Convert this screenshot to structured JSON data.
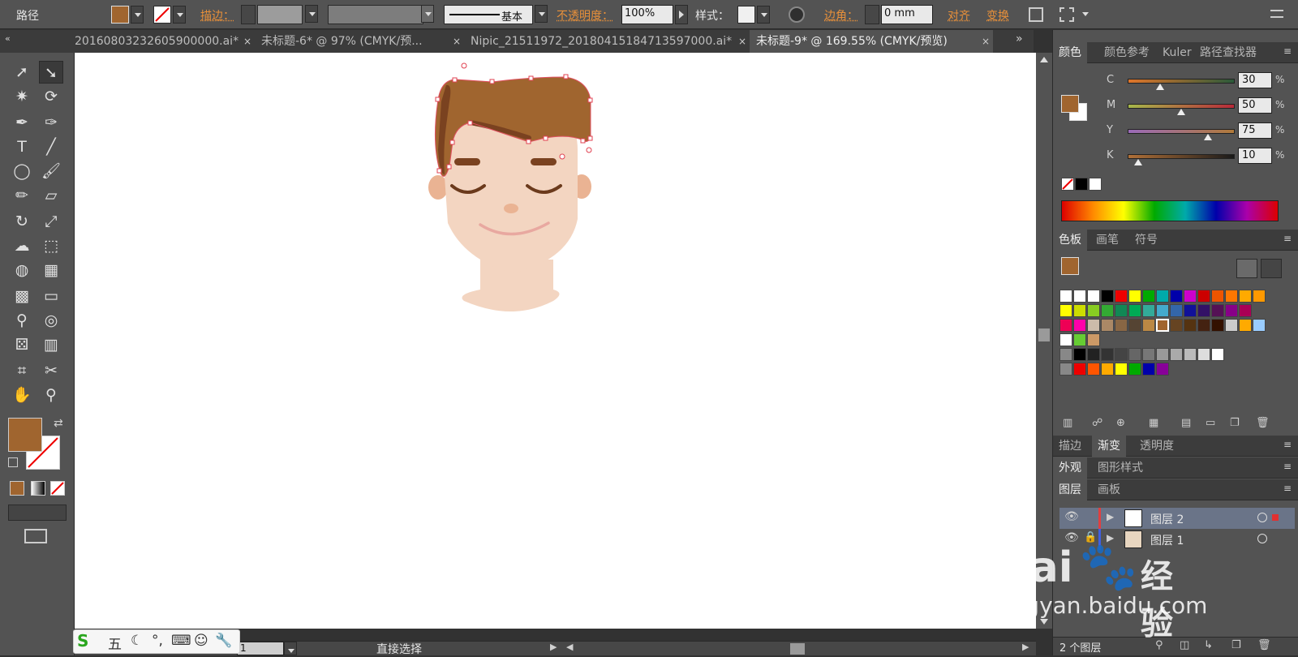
{
  "control_bar": {
    "object_type": "路径",
    "stroke_label": "描边：",
    "stroke_style": "基本",
    "opacity_label": "不透明度：",
    "opacity_value": "100%",
    "style_label": "样式：",
    "corner_label": "边角：",
    "corner_value": "0 mm",
    "align_label": "对齐",
    "transform_label": "变换"
  },
  "tabs": [
    {
      "label": "20160803232605900000.ai*",
      "close": "×"
    },
    {
      "label": "未标题-6* @ 97% (CMYK/预...",
      "close": "×"
    },
    {
      "label": "Nipic_21511972_20180415184713597000.ai*",
      "close": "×"
    },
    {
      "label": "未标题-9* @ 169.55% (CMYK/预览)",
      "close": "×"
    }
  ],
  "color_panel": {
    "tabs": [
      "颜色",
      "颜色参考",
      "Kuler",
      "路径查找器"
    ],
    "sliders": [
      {
        "key": "C",
        "value": "30",
        "pct": "%",
        "level": 0.3
      },
      {
        "key": "M",
        "value": "50",
        "pct": "%",
        "level": 0.5
      },
      {
        "key": "Y",
        "value": "75",
        "pct": "%",
        "level": 0.75
      },
      {
        "key": "K",
        "value": "10",
        "pct": "%",
        "level": 0.1
      }
    ]
  },
  "swatches_panel": {
    "tabs": [
      "色板",
      "画笔",
      "符号"
    ]
  },
  "stroke_panel": {
    "tabs": [
      "描边",
      "渐变",
      "透明度"
    ]
  },
  "appearance_panel": {
    "tabs": [
      "外观",
      "图形样式"
    ]
  },
  "layers_panel": {
    "tabs": [
      "图层",
      "画板"
    ],
    "layers": [
      {
        "name": "图层 2"
      },
      {
        "name": "图层 1"
      }
    ],
    "count_label": "2 个图层"
  },
  "status_bar": {
    "artboard_number": "1",
    "tool_name": "直接选择"
  },
  "ime_bar": {
    "logo": "S",
    "mode": "五"
  },
  "watermark": {
    "brand": "Bai",
    "brand2": "经验",
    "url": "jingyan.baidu.com"
  },
  "colors": {
    "fill": "#a0652f",
    "hair": "#a0652f",
    "skin": "#f3d5c1",
    "ear": "#eab393",
    "brow": "#7a4220"
  }
}
